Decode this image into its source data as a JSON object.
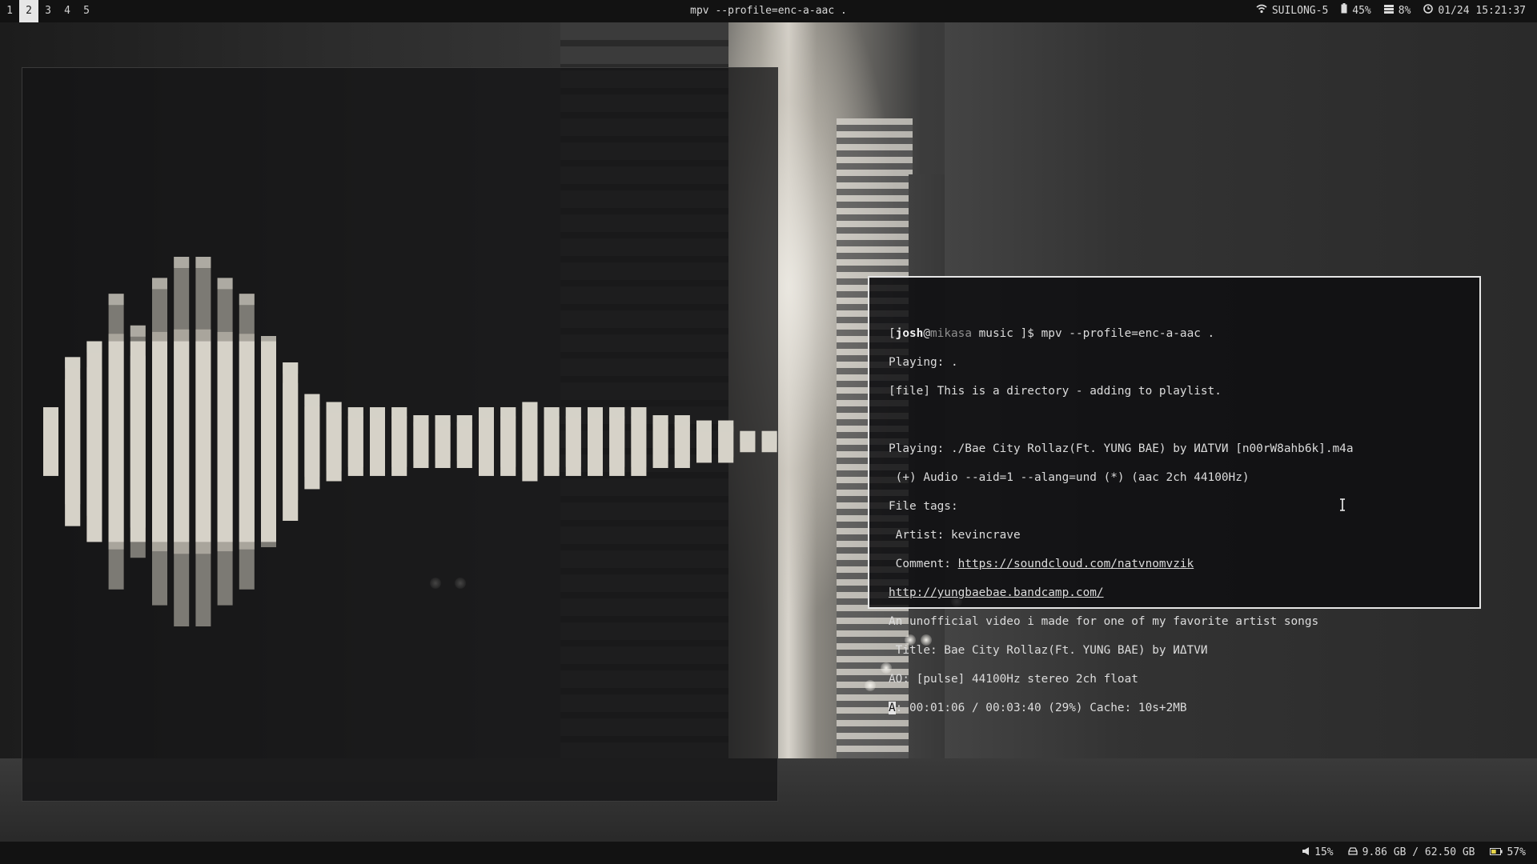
{
  "topbar": {
    "workspaces": [
      "1",
      "2",
      "3",
      "4",
      "5"
    ],
    "active_workspace": "2",
    "window_title": "mpv --profile=enc-a-aac .",
    "wifi_icon": "wifi-icon",
    "wifi_name": "SUILONG-5",
    "battery_icon": "battery-icon",
    "battery_value": "45%",
    "memory_icon": "memory-icon",
    "memory_value": "8%",
    "clock_icon": "clock-icon",
    "datetime": "01/24 15:21:37"
  },
  "terminal": {
    "prompt_open": "[",
    "user": "josh",
    "at": "@",
    "host": "mikasa",
    "cwd": " music ]$ ",
    "command": "mpv --profile=enc-a-aac .",
    "line_playing_dir": "Playing: .",
    "line_file": "[file] This is a directory - adding to playlist.",
    "line_playing_track": "Playing: ./Bae City Rollaz(Ft. YUNG BAE) by ИΔТVИ [n00rW8ahb6k].m4a",
    "line_audio": " (+) Audio --aid=1 --alang=und (*) (aac 2ch 44100Hz)",
    "line_file_tags": "File tags:",
    "line_artist": " Artist: kevincrave",
    "comment_label": " Comment: ",
    "comment_link": "https://soundcloud.com/natvnomvzik",
    "link_bandcamp": "http://yungbaebae.bandcamp.com/",
    "line_description": "An unofficial video i made for one of my favorite artist songs",
    "line_title": " Title: Bae City Rollaz(Ft. YUNG BAE) by ИΔТVИ",
    "line_ao": "AO: [pulse] 44100Hz stereo 2ch float",
    "status_cursor_char": "A",
    "status_rest": ": 00:01:06 / 00:03:40 (29%) Cache: 10s+2MB",
    "playback_progress": 0.29
  },
  "visualizer": {
    "bar_levels": [
      0.13,
      0.32,
      0.38,
      0.56,
      0.44,
      0.62,
      0.7,
      0.7,
      0.62,
      0.56,
      0.4,
      0.3,
      0.18,
      0.15,
      0.13,
      0.13,
      0.13,
      0.1,
      0.1,
      0.1,
      0.13,
      0.13,
      0.15,
      0.13,
      0.13,
      0.13,
      0.13,
      0.13,
      0.1,
      0.1,
      0.08,
      0.08,
      0.04,
      0.04
    ],
    "colors": {
      "light": "#d6d2c8",
      "mid": "#a9a59c",
      "dark": "#7c7a74"
    }
  },
  "bottombar": {
    "volume_icon": "speaker-icon",
    "volume": "15%",
    "disk_icon": "disk-icon",
    "disk": "9.86 GB / 62.50 GB",
    "battery_icon": "battery-icon",
    "battery": "57%",
    "battery_color": "#e5d44a"
  }
}
